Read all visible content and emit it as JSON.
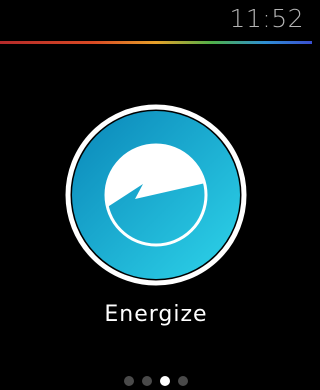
{
  "status": {
    "time": "11:52"
  },
  "colors": {
    "background": "#000000",
    "time_text": "#b4b4b4",
    "icon_gradient_start": "#0a86b8",
    "icon_gradient_end": "#2ed4ea",
    "icon_ring": "#ffffff",
    "dot_active": "#ffffff",
    "dot_inactive": "#4a4a4a",
    "rainbow": [
      "#b42a2a",
      "#d94a24",
      "#e7a12a",
      "#4fb04a",
      "#2f8fd4",
      "#3a4fd0"
    ]
  },
  "app": {
    "name": "Energize",
    "icon": "energize-bolt-gauge-icon"
  },
  "pagination": {
    "total": 4,
    "active_index": 2
  }
}
